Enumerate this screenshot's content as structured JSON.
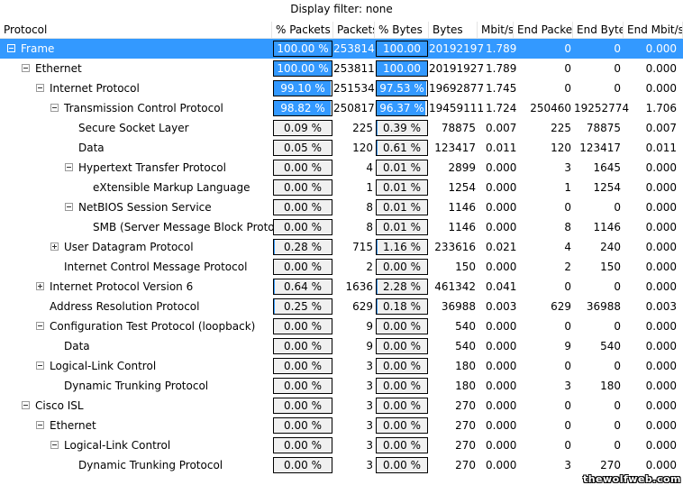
{
  "display_filter": "Display filter: none",
  "columns": [
    "Protocol",
    "% Packets",
    "Packets",
    "% Bytes",
    "Bytes",
    "Mbit/s",
    "End Packets",
    "End Bytes",
    "End Mbit/s"
  ],
  "rows": [
    {
      "protocol": "Frame",
      "depth": 0,
      "expander": "minus",
      "selected": true,
      "pct_packets": "100.00 %",
      "pct_packets_value": 100.0,
      "packets": "253814",
      "pct_bytes": "100.00 %",
      "pct_bytes_value": 100.0,
      "bytes": "20192197",
      "mbits": "1.789",
      "end_packets": "0",
      "end_bytes": "0",
      "end_mbits": "0.000"
    },
    {
      "protocol": "Ethernet",
      "depth": 1,
      "expander": "minus",
      "selected": false,
      "pct_packets": "100.00 %",
      "pct_packets_value": 100.0,
      "packets": "253811",
      "pct_bytes": "100.00 %",
      "pct_bytes_value": 100.0,
      "bytes": "20191927",
      "mbits": "1.789",
      "end_packets": "0",
      "end_bytes": "0",
      "end_mbits": "0.000"
    },
    {
      "protocol": "Internet Protocol",
      "depth": 2,
      "expander": "minus",
      "selected": false,
      "pct_packets": "99.10 %",
      "pct_packets_value": 99.1,
      "packets": "251534",
      "pct_bytes": "97.53 %",
      "pct_bytes_value": 97.53,
      "bytes": "19692877",
      "mbits": "1.745",
      "end_packets": "0",
      "end_bytes": "0",
      "end_mbits": "0.000"
    },
    {
      "protocol": "Transmission Control Protocol",
      "depth": 3,
      "expander": "minus",
      "selected": false,
      "pct_packets": "98.82 %",
      "pct_packets_value": 98.82,
      "packets": "250817",
      "pct_bytes": "96.37 %",
      "pct_bytes_value": 96.37,
      "bytes": "19459111",
      "mbits": "1.724",
      "end_packets": "250460",
      "end_bytes": "19252774",
      "end_mbits": "1.706"
    },
    {
      "protocol": "Secure Socket Layer",
      "depth": 4,
      "expander": "none",
      "selected": false,
      "pct_packets": "0.09 %",
      "pct_packets_value": 0.09,
      "packets": "225",
      "pct_bytes": "0.39 %",
      "pct_bytes_value": 0.39,
      "bytes": "78875",
      "mbits": "0.007",
      "end_packets": "225",
      "end_bytes": "78875",
      "end_mbits": "0.007"
    },
    {
      "protocol": "Data",
      "depth": 4,
      "expander": "none",
      "selected": false,
      "pct_packets": "0.05 %",
      "pct_packets_value": 0.05,
      "packets": "120",
      "pct_bytes": "0.61 %",
      "pct_bytes_value": 0.61,
      "bytes": "123417",
      "mbits": "0.011",
      "end_packets": "120",
      "end_bytes": "123417",
      "end_mbits": "0.011"
    },
    {
      "protocol": "Hypertext Transfer Protocol",
      "depth": 4,
      "expander": "minus",
      "selected": false,
      "pct_packets": "0.00 %",
      "pct_packets_value": 0.0,
      "packets": "4",
      "pct_bytes": "0.01 %",
      "pct_bytes_value": 0.01,
      "bytes": "2899",
      "mbits": "0.000",
      "end_packets": "3",
      "end_bytes": "1645",
      "end_mbits": "0.000"
    },
    {
      "protocol": "eXtensible Markup Language",
      "depth": 5,
      "expander": "none",
      "selected": false,
      "pct_packets": "0.00 %",
      "pct_packets_value": 0.0,
      "packets": "1",
      "pct_bytes": "0.01 %",
      "pct_bytes_value": 0.01,
      "bytes": "1254",
      "mbits": "0.000",
      "end_packets": "1",
      "end_bytes": "1254",
      "end_mbits": "0.000"
    },
    {
      "protocol": "NetBIOS Session Service",
      "depth": 4,
      "expander": "minus",
      "selected": false,
      "pct_packets": "0.00 %",
      "pct_packets_value": 0.0,
      "packets": "8",
      "pct_bytes": "0.01 %",
      "pct_bytes_value": 0.01,
      "bytes": "1146",
      "mbits": "0.000",
      "end_packets": "0",
      "end_bytes": "0",
      "end_mbits": "0.000"
    },
    {
      "protocol": "SMB (Server Message Block Protocol)",
      "depth": 5,
      "expander": "none",
      "selected": false,
      "pct_packets": "0.00 %",
      "pct_packets_value": 0.0,
      "packets": "8",
      "pct_bytes": "0.01 %",
      "pct_bytes_value": 0.01,
      "bytes": "1146",
      "mbits": "0.000",
      "end_packets": "8",
      "end_bytes": "1146",
      "end_mbits": "0.000"
    },
    {
      "protocol": "User Datagram Protocol",
      "depth": 3,
      "expander": "plus",
      "selected": false,
      "pct_packets": "0.28 %",
      "pct_packets_value": 0.28,
      "packets": "715",
      "pct_bytes": "1.16 %",
      "pct_bytes_value": 1.16,
      "bytes": "233616",
      "mbits": "0.021",
      "end_packets": "4",
      "end_bytes": "240",
      "end_mbits": "0.000"
    },
    {
      "protocol": "Internet Control Message Protocol",
      "depth": 3,
      "expander": "none",
      "selected": false,
      "pct_packets": "0.00 %",
      "pct_packets_value": 0.0,
      "packets": "2",
      "pct_bytes": "0.00 %",
      "pct_bytes_value": 0.0,
      "bytes": "150",
      "mbits": "0.000",
      "end_packets": "2",
      "end_bytes": "150",
      "end_mbits": "0.000"
    },
    {
      "protocol": "Internet Protocol Version 6",
      "depth": 2,
      "expander": "plus",
      "selected": false,
      "pct_packets": "0.64 %",
      "pct_packets_value": 0.64,
      "packets": "1636",
      "pct_bytes": "2.28 %",
      "pct_bytes_value": 2.28,
      "bytes": "461342",
      "mbits": "0.041",
      "end_packets": "0",
      "end_bytes": "0",
      "end_mbits": "0.000"
    },
    {
      "protocol": "Address Resolution Protocol",
      "depth": 2,
      "expander": "none",
      "selected": false,
      "pct_packets": "0.25 %",
      "pct_packets_value": 0.25,
      "packets": "629",
      "pct_bytes": "0.18 %",
      "pct_bytes_value": 0.18,
      "bytes": "36988",
      "mbits": "0.003",
      "end_packets": "629",
      "end_bytes": "36988",
      "end_mbits": "0.003"
    },
    {
      "protocol": "Configuration Test Protocol (loopback)",
      "depth": 2,
      "expander": "minus",
      "selected": false,
      "pct_packets": "0.00 %",
      "pct_packets_value": 0.0,
      "packets": "9",
      "pct_bytes": "0.00 %",
      "pct_bytes_value": 0.0,
      "bytes": "540",
      "mbits": "0.000",
      "end_packets": "0",
      "end_bytes": "0",
      "end_mbits": "0.000"
    },
    {
      "protocol": "Data",
      "depth": 3,
      "expander": "none",
      "selected": false,
      "pct_packets": "0.00 %",
      "pct_packets_value": 0.0,
      "packets": "9",
      "pct_bytes": "0.00 %",
      "pct_bytes_value": 0.0,
      "bytes": "540",
      "mbits": "0.000",
      "end_packets": "9",
      "end_bytes": "540",
      "end_mbits": "0.000"
    },
    {
      "protocol": "Logical-Link Control",
      "depth": 2,
      "expander": "minus",
      "selected": false,
      "pct_packets": "0.00 %",
      "pct_packets_value": 0.0,
      "packets": "3",
      "pct_bytes": "0.00 %",
      "pct_bytes_value": 0.0,
      "bytes": "180",
      "mbits": "0.000",
      "end_packets": "0",
      "end_bytes": "0",
      "end_mbits": "0.000"
    },
    {
      "protocol": "Dynamic Trunking Protocol",
      "depth": 3,
      "expander": "none",
      "selected": false,
      "pct_packets": "0.00 %",
      "pct_packets_value": 0.0,
      "packets": "3",
      "pct_bytes": "0.00 %",
      "pct_bytes_value": 0.0,
      "bytes": "180",
      "mbits": "0.000",
      "end_packets": "3",
      "end_bytes": "180",
      "end_mbits": "0.000"
    },
    {
      "protocol": "Cisco ISL",
      "depth": 1,
      "expander": "minus",
      "selected": false,
      "pct_packets": "0.00 %",
      "pct_packets_value": 0.0,
      "packets": "3",
      "pct_bytes": "0.00 %",
      "pct_bytes_value": 0.0,
      "bytes": "270",
      "mbits": "0.000",
      "end_packets": "0",
      "end_bytes": "0",
      "end_mbits": "0.000"
    },
    {
      "protocol": "Ethernet",
      "depth": 2,
      "expander": "minus",
      "selected": false,
      "pct_packets": "0.00 %",
      "pct_packets_value": 0.0,
      "packets": "3",
      "pct_bytes": "0.00 %",
      "pct_bytes_value": 0.0,
      "bytes": "270",
      "mbits": "0.000",
      "end_packets": "0",
      "end_bytes": "0",
      "end_mbits": "0.000"
    },
    {
      "protocol": "Logical-Link Control",
      "depth": 3,
      "expander": "minus",
      "selected": false,
      "pct_packets": "0.00 %",
      "pct_packets_value": 0.0,
      "packets": "3",
      "pct_bytes": "0.00 %",
      "pct_bytes_value": 0.0,
      "bytes": "270",
      "mbits": "0.000",
      "end_packets": "0",
      "end_bytes": "0",
      "end_mbits": "0.000"
    },
    {
      "protocol": "Dynamic Trunking Protocol",
      "depth": 4,
      "expander": "none",
      "selected": false,
      "pct_packets": "0.00 %",
      "pct_packets_value": 0.0,
      "packets": "3",
      "pct_bytes": "0.00 %",
      "pct_bytes_value": 0.0,
      "bytes": "270",
      "mbits": "0.000",
      "end_packets": "3",
      "end_bytes": "270",
      "end_mbits": "0.000"
    }
  ],
  "watermark": "thewolfweb.com",
  "colors": {
    "selection": "#3399ff",
    "bar_background": "#f0f0f0"
  }
}
